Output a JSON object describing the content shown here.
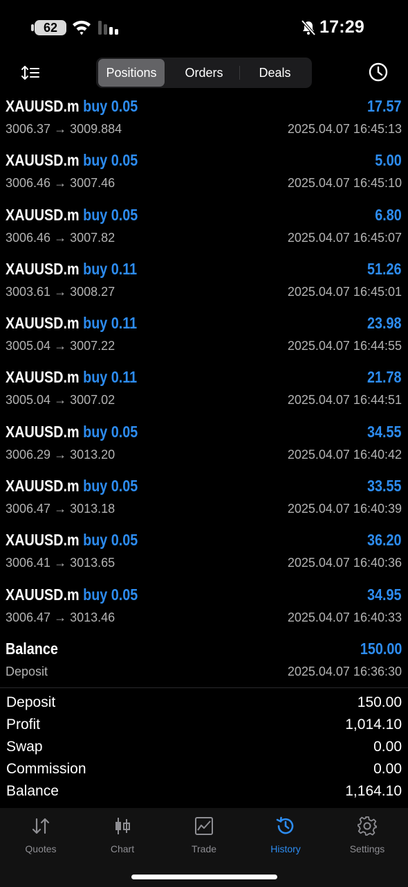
{
  "status_bar": {
    "battery": "62",
    "time": "17:29"
  },
  "tabs": {
    "positions": "Positions",
    "orders": "Orders",
    "deals": "Deals"
  },
  "history": [
    {
      "symbol": "XAUUSD.m",
      "type_volume": "buy 0.05",
      "prices": "3006.37 → 3009.884",
      "profit": "17.57",
      "time": "2025.04.07 16:45:13"
    },
    {
      "symbol": "XAUUSD.m",
      "type_volume": "buy 0.05",
      "prices": "3006.46 → 3007.46",
      "profit": "5.00",
      "time": "2025.04.07 16:45:10"
    },
    {
      "symbol": "XAUUSD.m",
      "type_volume": "buy 0.05",
      "prices": "3006.46 → 3007.82",
      "profit": "6.80",
      "time": "2025.04.07 16:45:07"
    },
    {
      "symbol": "XAUUSD.m",
      "type_volume": "buy 0.11",
      "prices": "3003.61 → 3008.27",
      "profit": "51.26",
      "time": "2025.04.07 16:45:01"
    },
    {
      "symbol": "XAUUSD.m",
      "type_volume": "buy 0.11",
      "prices": "3005.04 → 3007.22",
      "profit": "23.98",
      "time": "2025.04.07 16:44:55"
    },
    {
      "symbol": "XAUUSD.m",
      "type_volume": "buy 0.11",
      "prices": "3005.04 → 3007.02",
      "profit": "21.78",
      "time": "2025.04.07 16:44:51"
    },
    {
      "symbol": "XAUUSD.m",
      "type_volume": "buy 0.05",
      "prices": "3006.29 → 3013.20",
      "profit": "34.55",
      "time": "2025.04.07 16:40:42"
    },
    {
      "symbol": "XAUUSD.m",
      "type_volume": "buy 0.05",
      "prices": "3006.47 → 3013.18",
      "profit": "33.55",
      "time": "2025.04.07 16:40:39"
    },
    {
      "symbol": "XAUUSD.m",
      "type_volume": "buy 0.05",
      "prices": "3006.41 → 3013.65",
      "profit": "36.20",
      "time": "2025.04.07 16:40:36"
    },
    {
      "symbol": "XAUUSD.m",
      "type_volume": "buy 0.05",
      "prices": "3006.47 → 3013.46",
      "profit": "34.95",
      "time": "2025.04.07 16:40:33"
    }
  ],
  "balance_entry": {
    "title": "Balance",
    "subtitle": "Deposit",
    "amount": "150.00",
    "time": "2025.04.07 16:36:30"
  },
  "summary": {
    "deposit_label": "Deposit",
    "deposit": "150.00",
    "profit_label": "Profit",
    "profit": "1,014.10",
    "swap_label": "Swap",
    "swap": "0.00",
    "commission_label": "Commission",
    "commission": "0.00",
    "balance_label": "Balance",
    "balance": "1,164.10"
  },
  "tabbar": {
    "quotes": "Quotes",
    "chart": "Chart",
    "trade": "Trade",
    "history": "History",
    "settings": "Settings"
  },
  "colors": {
    "accent": "#2d8cf0",
    "muted": "#b3b3b3",
    "background": "#000000"
  }
}
